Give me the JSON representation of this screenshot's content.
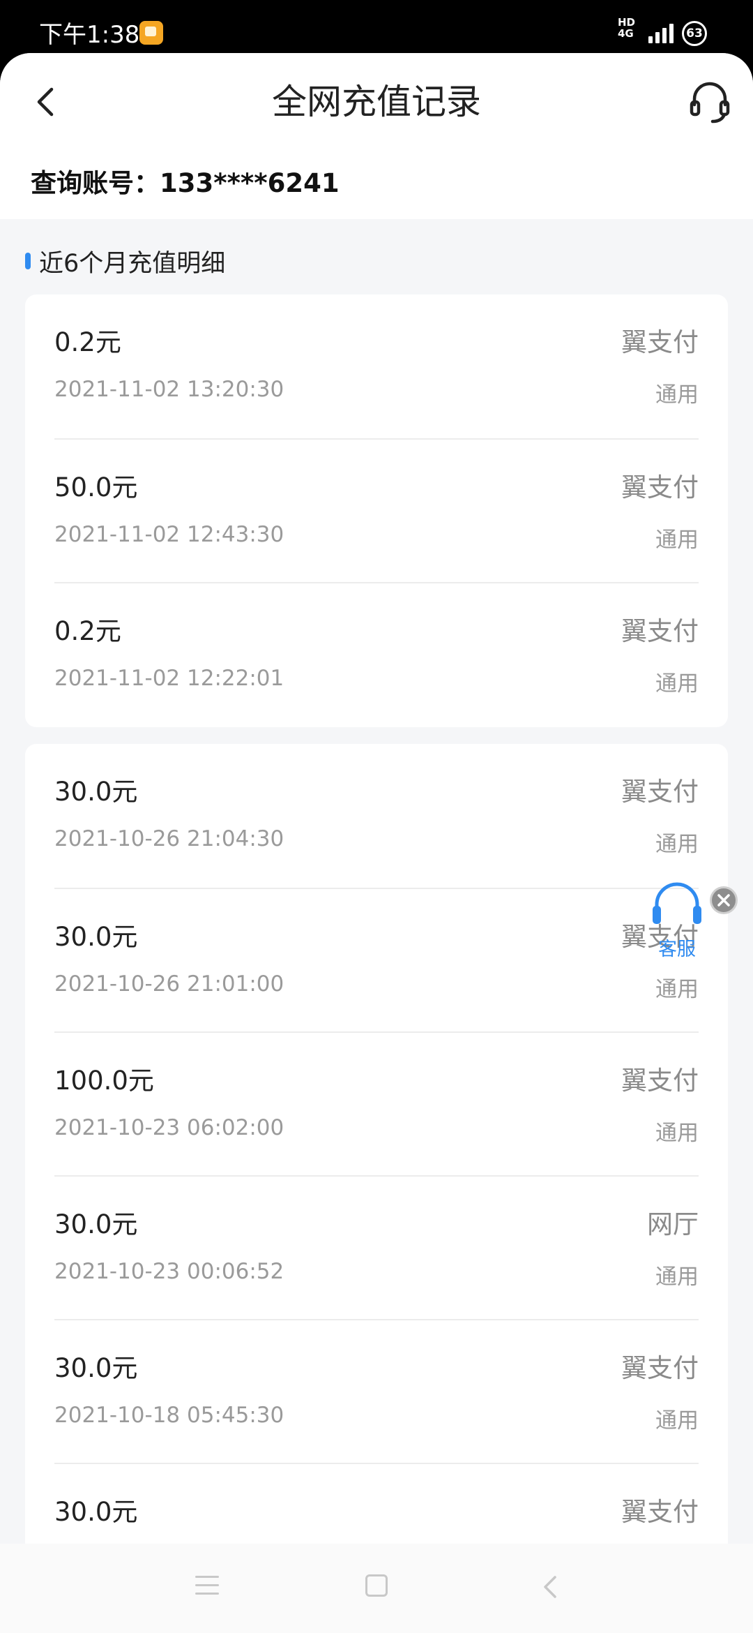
{
  "status_bar": {
    "time": "下午1:38",
    "network": "4G",
    "hd_label": "HD",
    "battery": "63"
  },
  "header": {
    "title": "全网充值记录",
    "back_icon": "chevron-left-icon",
    "service_icon": "headset-icon"
  },
  "account": {
    "label": "查询账号：",
    "number": "133****6241",
    "full": "查询账号：133****6241"
  },
  "section": {
    "title": "近6个月充值明细",
    "accent": "#2f8bf0"
  },
  "groups": [
    {
      "records": [
        {
          "amount": "0.2元",
          "channel": "翼支付",
          "time": "2021-11-02 13:20:30",
          "scope": "通用"
        },
        {
          "amount": "50.0元",
          "channel": "翼支付",
          "time": "2021-11-02 12:43:30",
          "scope": "通用"
        },
        {
          "amount": "0.2元",
          "channel": "翼支付",
          "time": "2021-11-02 12:22:01",
          "scope": "通用"
        }
      ]
    },
    {
      "records": [
        {
          "amount": "30.0元",
          "channel": "翼支付",
          "time": "2021-10-26 21:04:30",
          "scope": "通用"
        },
        {
          "amount": "30.0元",
          "channel": "翼支付",
          "time": "2021-10-26 21:01:00",
          "scope": "通用"
        },
        {
          "amount": "100.0元",
          "channel": "翼支付",
          "time": "2021-10-23 06:02:00",
          "scope": "通用"
        },
        {
          "amount": "30.0元",
          "channel": "网厅",
          "time": "2021-10-23 00:06:52",
          "scope": "通用"
        },
        {
          "amount": "30.0元",
          "channel": "翼支付",
          "time": "2021-10-18 05:45:30",
          "scope": "通用"
        },
        {
          "amount": "30.0元",
          "channel": "翼支付",
          "time": "",
          "scope": ""
        }
      ]
    }
  ],
  "floating_service": {
    "label": "客服",
    "color": "#2f8bf0"
  },
  "nav": {
    "menu_icon": "menu-icon",
    "home_icon": "home-icon",
    "back_icon": "back-icon"
  }
}
